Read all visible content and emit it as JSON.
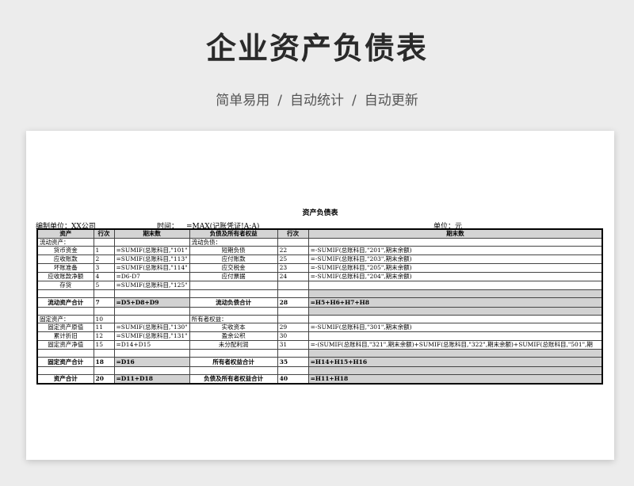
{
  "header": {
    "title": "企业资产负债表",
    "tags": [
      "简单易用",
      "自动统计",
      "自动更新"
    ],
    "separator": "/"
  },
  "sheet": {
    "title": "资产负债表",
    "unit_label": "编制单位：XX公司",
    "time_label": "时间：",
    "time_formula": "=MAX(记账凭证!A:A)",
    "money_label": "单位：元"
  },
  "columns": [
    "资产",
    "行次",
    "期末数",
    "负债及所有者权益",
    "行次",
    "期末数"
  ],
  "rows": [
    {
      "type": "section",
      "a": "流动资产：",
      "an": "",
      "av": "",
      "l": "流动负债：",
      "ln": "",
      "lv": ""
    },
    {
      "type": "item",
      "a": "货币资金",
      "an": "1",
      "av": "=SUMIF(总账科目,\"101\"",
      "l": "短期负债",
      "ln": "22",
      "lv": "=-SUMIF(总账科目,\"201\",期末余额)"
    },
    {
      "type": "item",
      "a": "应收账款",
      "an": "2",
      "av": "=SUMIF(总账科目,\"113\"",
      "l": "应付账款",
      "ln": "25",
      "lv": "=-SUMIF(总账科目,\"203\",期末余额)"
    },
    {
      "type": "item",
      "a": "坏账准备",
      "an": "3",
      "av": "=SUMIF(总账科目,\"114\"",
      "l": "应交税金",
      "ln": "23",
      "lv": "=-SUMIF(总账科目,\"205\",期末余额)"
    },
    {
      "type": "item",
      "a": "应收账款净额",
      "an": "4",
      "av": "=D6-D7",
      "l": "应付票据",
      "ln": "24",
      "lv": "=-SUMIF(总账科目,\"204\",期末余额)"
    },
    {
      "type": "item",
      "a": "存货",
      "an": "5",
      "av": "=SUMIF(总账科目,\"125\"",
      "l": "",
      "ln": "",
      "lv": ""
    },
    {
      "type": "spacer"
    },
    {
      "type": "total",
      "a": "流动资产合计",
      "an": "7",
      "av": "=D5+D8+D9",
      "l": "流动负债合计",
      "ln": "28",
      "lv": "=H5+H6+H7+H8"
    },
    {
      "type": "spacer"
    },
    {
      "type": "section",
      "a": "固定资产：",
      "an": "10",
      "av": "",
      "l": "所有者权益：",
      "ln": "",
      "lv": ""
    },
    {
      "type": "item",
      "a": "固定资产原值",
      "an": "11",
      "av": "=SUMIF(总账科目,\"130\"",
      "l": "实收资本",
      "ln": "29",
      "lv": "=-SUMIF(总账科目,\"301\",期末余额)"
    },
    {
      "type": "item",
      "a": "累计折旧",
      "an": "12",
      "av": "=SUMIF(总账科目,\"131\"",
      "l": "盈余公积",
      "ln": "30",
      "lv": ""
    },
    {
      "type": "item",
      "a": "固定资产净值",
      "an": "15",
      "av": "=D14+D15",
      "l": "未分配利润",
      "ln": "31",
      "lv": "=-(SUMIF(总账科目,\"321\",期末余额)+SUMIF(总账科目,\"322\",期末余额)+SUMIF(总账科目,\"501\",期"
    },
    {
      "type": "spacer"
    },
    {
      "type": "total",
      "a": "固定资产合计",
      "an": "18",
      "av": "=D16",
      "l": "所有者权益合计",
      "ln": "35",
      "lv": "=H14+H15+H16"
    },
    {
      "type": "spacer"
    },
    {
      "type": "total",
      "a": "资产合计",
      "an": "20",
      "av": "=D11+D18",
      "l": "负债及所有者权益合计",
      "ln": "40",
      "lv": "=H11+H18"
    }
  ]
}
